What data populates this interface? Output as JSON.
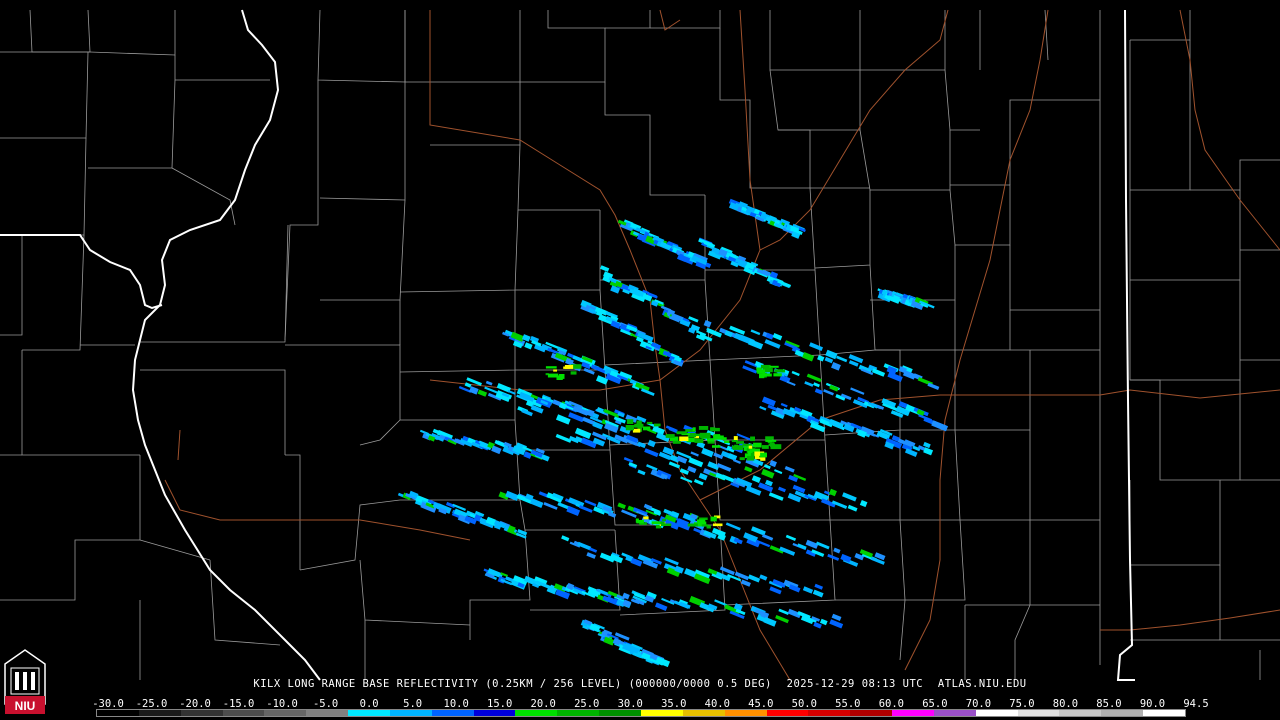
{
  "caption": {
    "product": "KILX LONG RANGE BASE REFLECTIVITY (0.25KM / 256 LEVEL) (000000/0000 0.5 DEG)",
    "timestamp": "2025-12-29 08:13 UTC",
    "site": "ATLAS.NIU.EDU"
  },
  "logo": {
    "text": "NIU"
  },
  "scale": {
    "labels": [
      "-30.0",
      "-25.0",
      "-20.0",
      "-15.0",
      "-10.0",
      "-5.0",
      "0.0",
      "5.0",
      "10.0",
      "15.0",
      "20.0",
      "25.0",
      "30.0",
      "35.0",
      "40.0",
      "45.0",
      "50.0",
      "55.0",
      "60.0",
      "65.0",
      "70.0",
      "75.0",
      "80.0",
      "85.0",
      "90.0",
      "94.5"
    ],
    "colors": [
      "#000000",
      "#1a1a1a",
      "#333333",
      "#4d4d4d",
      "#666666",
      "#808080",
      "#00e8ff",
      "#00b4ff",
      "#0064ff",
      "#0000dc",
      "#00e000",
      "#00b400",
      "#009000",
      "#ffff00",
      "#e6c000",
      "#ff9000",
      "#ff0000",
      "#d40000",
      "#b00000",
      "#ff00ff",
      "#9a50c8",
      "#ffffff",
      "#e0e0e0",
      "#c8c8c8",
      "#b0b0b0",
      "#ffffff"
    ]
  },
  "colors": {
    "state_border": "#ffffff",
    "county_border": "#9a9a9a",
    "highway": "#a0522d",
    "background": "#000000"
  }
}
